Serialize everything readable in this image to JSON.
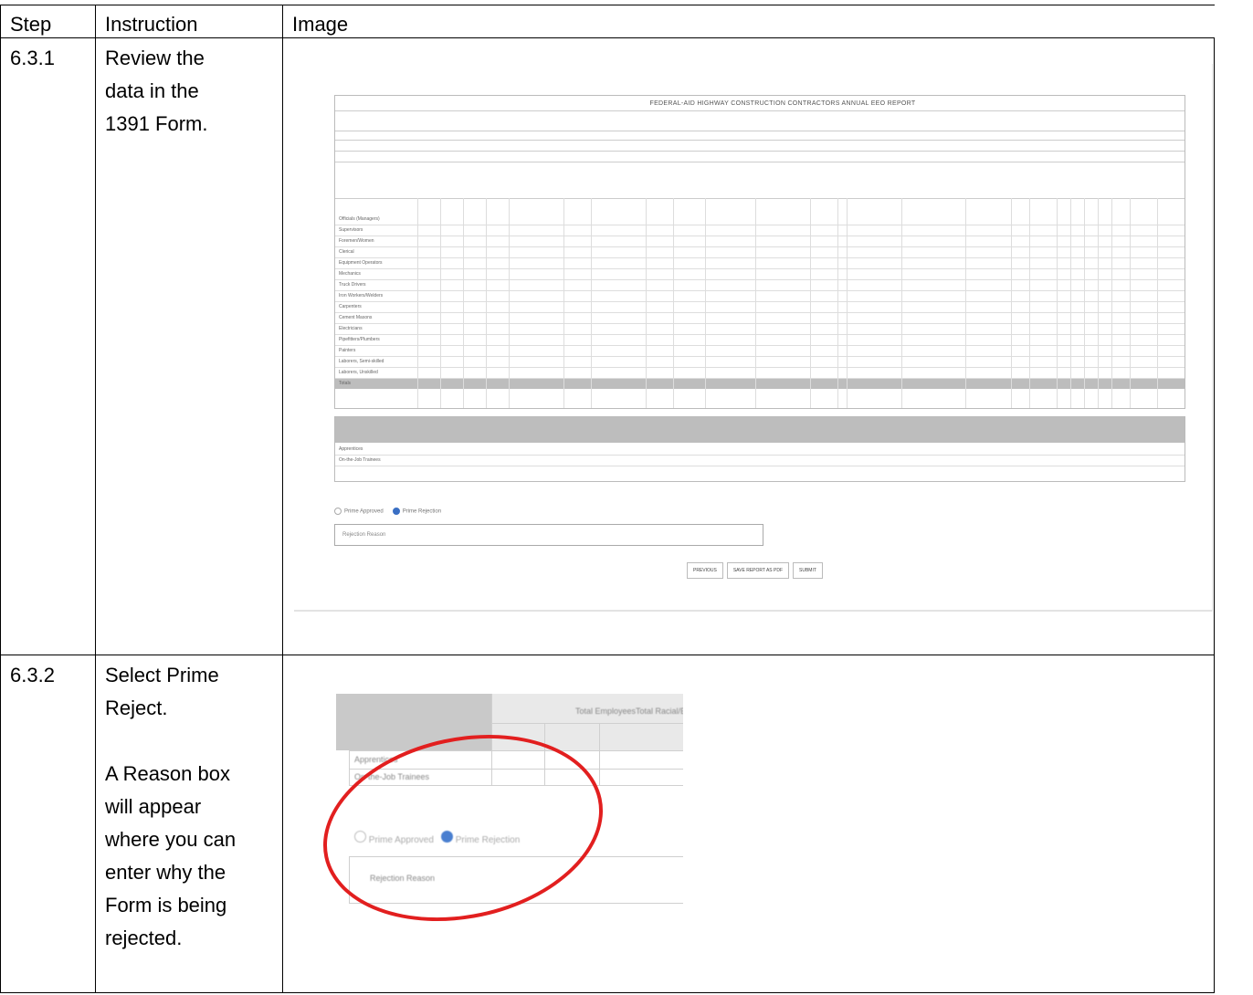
{
  "header": {
    "step": "Step",
    "instruction": "Instruction",
    "image": "Image"
  },
  "rows": [
    {
      "step": "6.3.1",
      "instruction": [
        "Review the",
        "data in the",
        "1391 Form."
      ],
      "screenshot": {
        "title": "FEDERAL-AID HIGHWAY CONSTRUCTION CONTRACTORS ANNUAL EEO REPORT",
        "job_categories": [
          "Officials (Managers)",
          "Supervisors",
          "Foremen/Women",
          "Clerical",
          "Equipment Operators",
          "Mechanics",
          "Truck Drivers",
          "Iron Workers/Welders",
          "Carpenters",
          "Cement Masons",
          "Electricians",
          "Pipefitters/Plumbers",
          "Painters",
          "Laborers, Semi-skilled",
          "Laborers, Unskilled",
          "Totals"
        ],
        "table_b_rows": [
          "Apprentices",
          "On-the-Job Trainees"
        ],
        "radio_options": [
          {
            "label": "Prime Approved",
            "selected": false
          },
          {
            "label": "Prime Rejection",
            "selected": true
          }
        ],
        "reason_placeholder": "Rejection Reason",
        "buttons": [
          "PREVIOUS",
          "SAVE REPORT AS PDF",
          "SUBMIT"
        ],
        "accent_color": "#3a6fc4"
      }
    },
    {
      "step": "6.3.2",
      "instruction": [
        "Select Prime",
        "Reject."
      ],
      "instruction_note": [
        "A Reason box",
        "will appear",
        "where you can",
        "enter why the",
        "Form is being",
        "rejected."
      ],
      "screenshot": {
        "header_labels": [
          "Total Employees",
          "Total Racial/E"
        ],
        "row_labels": [
          "Apprentices",
          "On-the-Job Trainees"
        ],
        "radio_options": [
          {
            "label": "Prime Approved",
            "selected": false
          },
          {
            "label": "Prime Rejection",
            "selected": true
          }
        ],
        "reason_placeholder": "Rejection Reason",
        "highlight_color": "#e21f1f"
      }
    }
  ]
}
